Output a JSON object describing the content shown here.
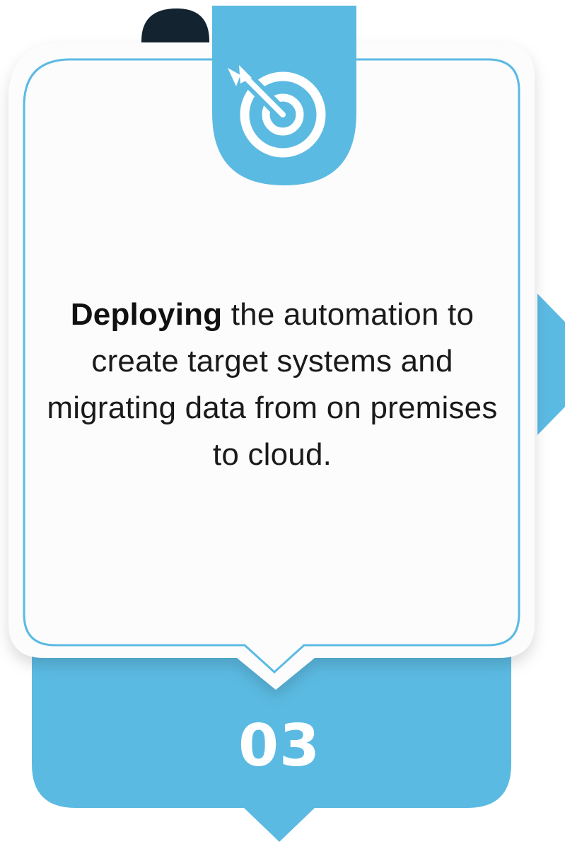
{
  "step": {
    "number": "03",
    "lead_word": "Deploying",
    "description": " the automation to create target systems and migrating data from on premises to cloud.",
    "icon": "target-arrow-icon"
  },
  "colors": {
    "accent": "#5BBAE2",
    "dark_tab": "#13232F",
    "card_fill": "#FCFCFC",
    "text": "#1A1A1A"
  }
}
